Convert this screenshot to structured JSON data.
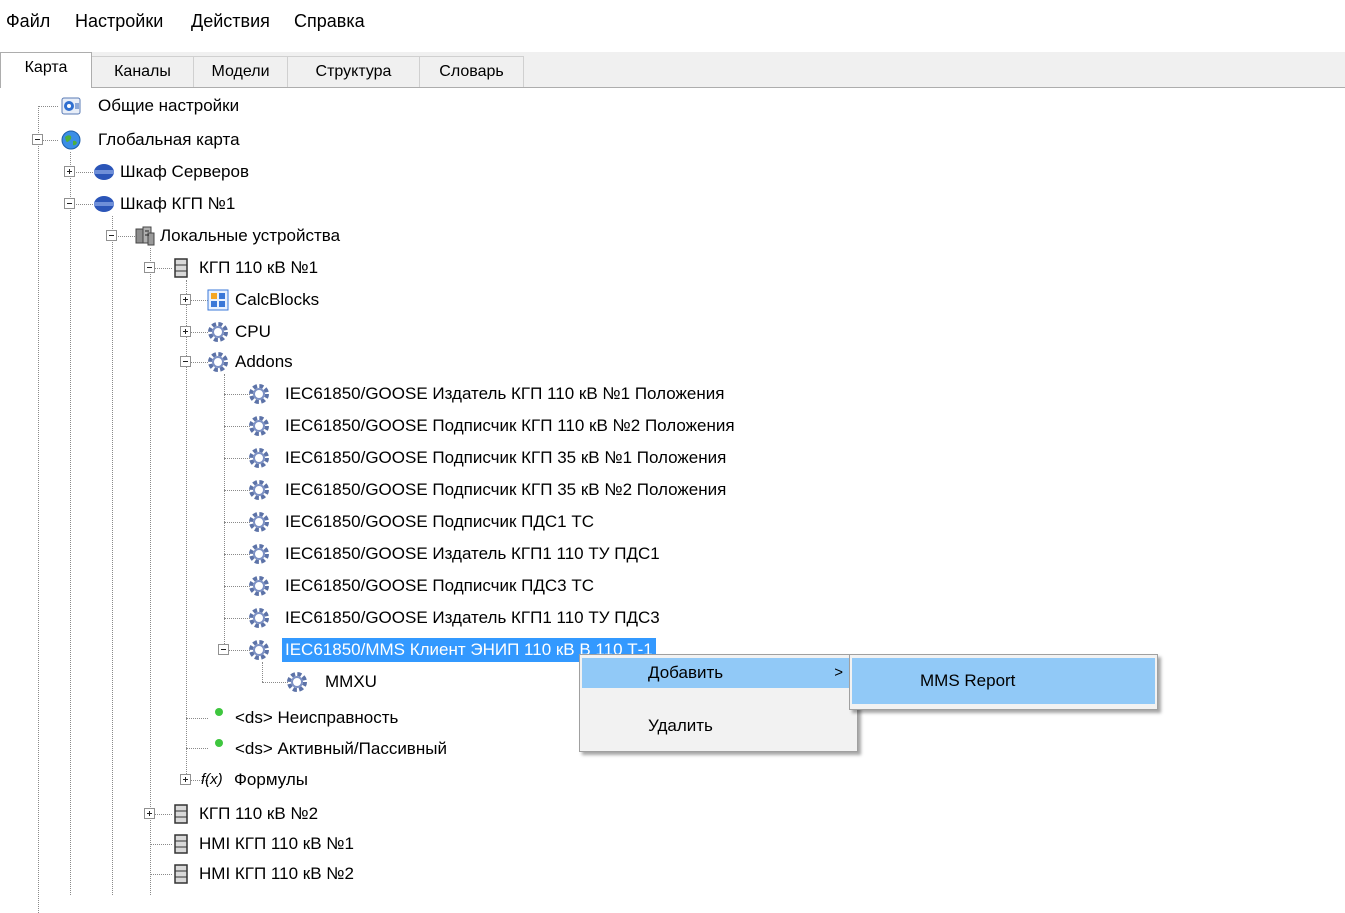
{
  "menu": {
    "file": "Файл",
    "settings": "Настройки",
    "actions": "Действия",
    "help": "Справка"
  },
  "tabs": {
    "map": "Карта",
    "channels": "Каналы",
    "models": "Модели",
    "structure": "Структура",
    "dictionary": "Словарь",
    "active": "Карта"
  },
  "tree": {
    "general_settings": "Общие настройки",
    "global_map": "Глобальная карта",
    "server_cabinet": "Шкаф Серверов",
    "kgp_cabinet": "Шкаф КГП №1",
    "local_devices": "Локальные устройства",
    "kgp_110_1": "КГП 110 кВ №1",
    "calcblocks": "CalcBlocks",
    "cpu": "CPU",
    "addons": "Addons",
    "addon_items": [
      "IEC61850/GOOSE Издатель КГП 110 кВ №1 Положения",
      "IEC61850/GOOSE Подписчик КГП 110 кВ №2 Положения",
      "IEC61850/GOOSE Подписчик КГП 35 кВ №1 Положения",
      "IEC61850/GOOSE Подписчик КГП 35 кВ №2 Положения",
      "IEC61850/GOOSE Подписчик ПДС1 ТС",
      "IEC61850/GOOSE Издатель КГП1 110 ТУ ПДС1",
      "IEC61850/GOOSE Подписчик ПДС3 ТС",
      "IEC61850/GOOSE Издатель КГП1 110 ТУ ПДС3"
    ],
    "mms_client": "IEC61850/MMS Клиент ЭНИП 110 кВ В 110 Т-1",
    "mmxu": "MMXU",
    "ds_fault": "<ds> Неисправность",
    "ds_active": "<ds> Активный/Пассивный",
    "formulas": "Формулы",
    "kgp_110_2": "КГП 110 кВ №2",
    "hmi_1": "HMI КГП 110 кВ №1",
    "hmi_2": "HMI КГП 110 кВ №2"
  },
  "context_menu": {
    "add": "Добавить",
    "add_arrow": ">",
    "delete": "Удалить"
  },
  "submenu": {
    "mms_report": "MMS Report"
  },
  "colors": {
    "selection": "#3399ff",
    "menu_highlight": "#91c9f7",
    "status_dot": "#3ec63e"
  },
  "icons": {
    "general_settings": "settings-app-icon",
    "global_map": "globe-icon",
    "cabinet": "cabinet-disc-icon",
    "local_devices": "network-devices-icon",
    "device": "server-icon",
    "calcblocks": "calc-blocks-icon",
    "module": "gear-icon",
    "ds": "green-dot-icon",
    "formulas": "function-icon"
  }
}
